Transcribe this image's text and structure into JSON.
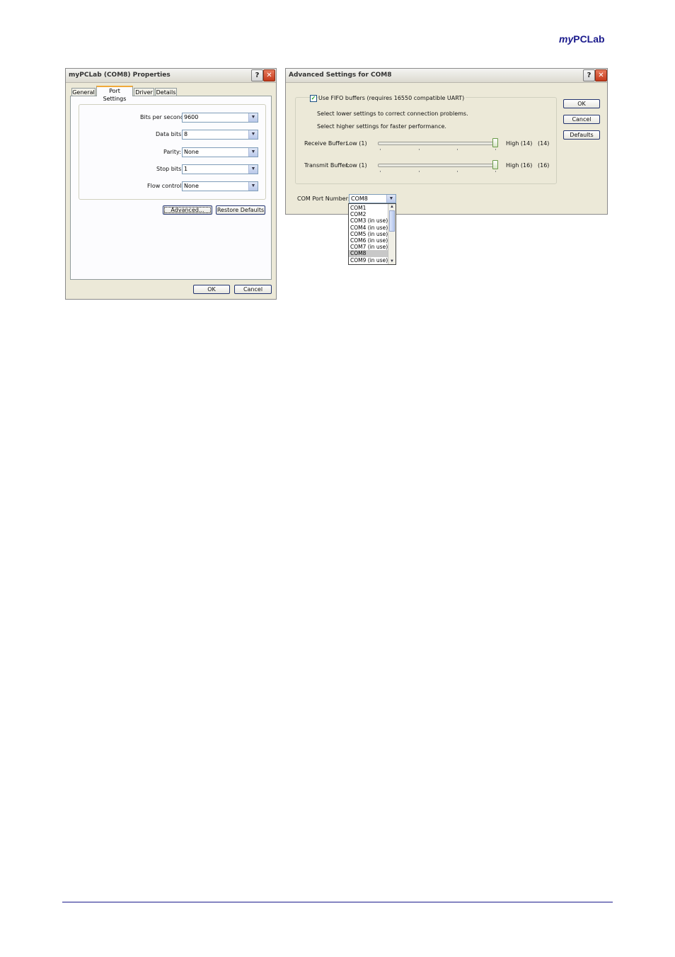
{
  "header": {
    "brand_prefix": "my",
    "brand_main": "PCLab"
  },
  "props_dialog": {
    "title": "myPCLab (COM8) Properties",
    "help": "?",
    "close": "✕",
    "tabs": [
      "General",
      "Port Settings",
      "Driver",
      "Details"
    ],
    "active_tab": "Port Settings",
    "fields": [
      {
        "label": "Bits per second:",
        "value": "9600"
      },
      {
        "label": "Data bits:",
        "value": "8"
      },
      {
        "label": "Parity:",
        "value": "None"
      },
      {
        "label": "Stop bits:",
        "value": "1"
      },
      {
        "label": "Flow control:",
        "value": "None"
      }
    ],
    "advanced_button": "Advanced...",
    "restore_button": "Restore Defaults",
    "ok_button": "OK",
    "cancel_button": "Cancel"
  },
  "advanced_dialog": {
    "title": "Advanced Settings for COM8",
    "help": "?",
    "close": "✕",
    "fifo_checkbox_label": "Use FIFO buffers (requires 16550 compatible UART)",
    "fifo_checked": true,
    "hint_lower": "Select lower settings to correct connection problems.",
    "hint_higher": "Select higher settings for faster performance.",
    "receive": {
      "label": "Receive Buffer:",
      "low": "Low (1)",
      "high": "High (14)",
      "value_text": "(14)",
      "level": 1.0
    },
    "transmit": {
      "label": "Transmit Buffer:",
      "low": "Low (1)",
      "high": "High (16)",
      "value_text": "(16)",
      "level": 1.0
    },
    "ok_button": "OK",
    "cancel_button": "Cancel",
    "defaults_button": "Defaults",
    "com_port_label": "COM Port Number:",
    "com_port_value": "COM8",
    "com_port_options": [
      "COM1",
      "COM2",
      "COM3 (in use)",
      "COM4 (in use)",
      "COM5 (in use)",
      "COM6 (in use)",
      "COM7 (in use)",
      "COM8",
      "COM9 (in use)"
    ],
    "selected_option": "COM8"
  }
}
